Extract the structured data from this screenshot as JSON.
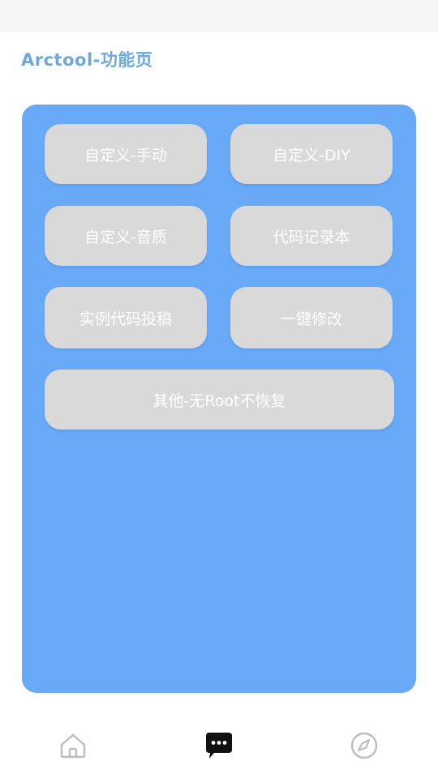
{
  "header": {
    "title": "Arctool-功能页"
  },
  "functions": [
    {
      "label": "自定义-手动"
    },
    {
      "label": "自定义-DIY"
    },
    {
      "label": "自定义-音质"
    },
    {
      "label": "代码记录本"
    },
    {
      "label": "实例代码投稿"
    },
    {
      "label": "一键修改"
    },
    {
      "label": "其他-无Root不恢复"
    }
  ],
  "bottom_nav": [
    {
      "icon": "home-icon",
      "active": false
    },
    {
      "icon": "chat-bubble-icon",
      "active": true
    },
    {
      "icon": "compass-icon",
      "active": false
    }
  ],
  "colors": {
    "title": "#6ca8de",
    "panel": "#68a9f8",
    "button": "#d9d9d9",
    "button_text": "#ffffff",
    "icon": "#bdbdbd",
    "active_icon": "#111111"
  }
}
